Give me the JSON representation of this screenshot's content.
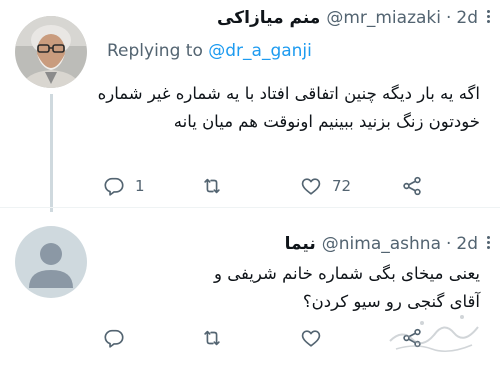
{
  "tweets": [
    {
      "display_name": "منم میازاکی",
      "handle": "@mr_miazaki",
      "separator": "·",
      "time": "2d",
      "replying_label": "Replying to",
      "replying_to": "@dr_a_ganji",
      "text": "اگه یه بار دیگه چنین اتفاقی افتاد با یه شماره غیر شماره خودتون زنگ بزنید ببینیم اونوقت هم میان یانه",
      "reply_count": "1",
      "retweet_count": "",
      "like_count": "72"
    },
    {
      "display_name": "نیما",
      "handle": "@nima_ashna",
      "separator": "·",
      "time": "2d",
      "text": "یعنی میخای بگی شماره خانم شریفی و آقای گنجی رو سیو کردن؟",
      "reply_count": "",
      "retweet_count": "",
      "like_count": ""
    }
  ],
  "icons": {
    "reply": "reply-icon",
    "retweet": "retweet-icon",
    "like": "heart-icon",
    "share": "share-icon",
    "more": "more-options-icon"
  },
  "colors": {
    "text": "#0f1419",
    "secondary": "#536471",
    "link": "#1d9bf0",
    "thread_line": "#cfd9de"
  }
}
